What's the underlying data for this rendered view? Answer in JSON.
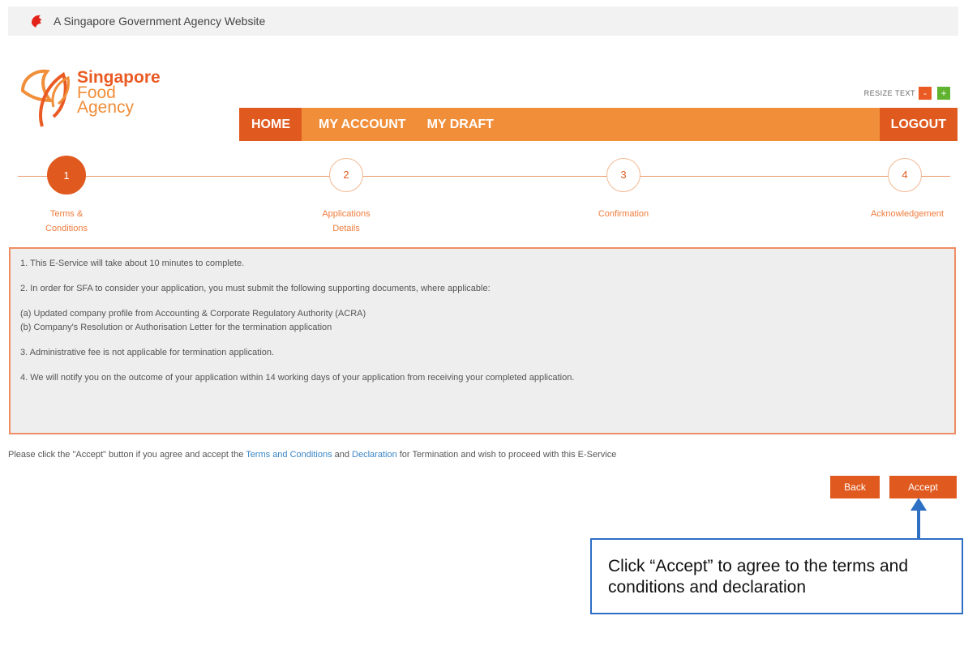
{
  "gov_bar": {
    "text": "A Singapore Government Agency Website"
  },
  "logo": {
    "line1": "Singapore",
    "line2": "Food",
    "line3": "Agency"
  },
  "resize": {
    "label": "RESIZE TEXT",
    "minus": "-",
    "plus": "+"
  },
  "nav": {
    "home": "HOME",
    "my_account": "MY ACCOUNT",
    "my_draft": "MY DRAFT",
    "logout": "LOGOUT"
  },
  "steps": [
    {
      "number": "1",
      "label_line1": "Terms &",
      "label_line2": "Conditions",
      "active": true
    },
    {
      "number": "2",
      "label_line1": "Applications",
      "label_line2": "Details",
      "active": false
    },
    {
      "number": "3",
      "label_line1": "Confirmation",
      "label_line2": "",
      "active": false
    },
    {
      "number": "4",
      "label_line1": "Acknowledgement",
      "label_line2": "",
      "active": false
    }
  ],
  "terms": {
    "item1": "1. This E-Service will take about 10 minutes to complete.",
    "item2": "2. In order for SFA to consider your application, you must submit the following supporting documents, where applicable:",
    "item2a": "(a) Updated company profile from Accounting & Corporate Regulatory Authority (ACRA)",
    "item2b": "(b) Company's Resolution or Authorisation Letter for the termination application",
    "item3": "3. Administrative fee is not applicable for termination application.",
    "item4": "4. We will notify you on the outcome of your application within 14 working days of your application from receiving your completed application."
  },
  "prompt": {
    "before": "Please click the \"Accept\" button if you agree and accept the ",
    "link_terms": "Terms and Conditions",
    "middle": " and ",
    "link_declaration": "Declaration",
    "after": " for Termination and wish to proceed with this E-Service"
  },
  "buttons": {
    "back": "Back",
    "accept": "Accept"
  },
  "callout": {
    "text": "Click “Accept” to agree to the terms and conditions and declaration"
  },
  "colors": {
    "primary": "#e05a1f",
    "nav": "#f18e3a",
    "link": "#3b86c6",
    "callout_border": "#2e70c4"
  }
}
